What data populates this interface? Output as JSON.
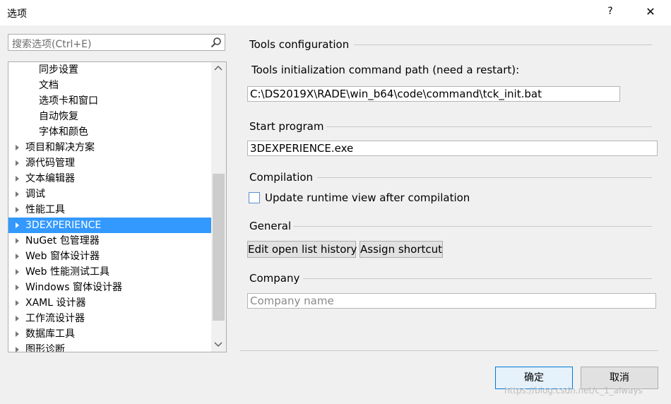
{
  "window": {
    "title": "选项",
    "help_glyph": "?",
    "close_glyph": "✕"
  },
  "search": {
    "placeholder": "搜索选项(Ctrl+E)"
  },
  "tree": {
    "items": [
      {
        "label": "同步设置",
        "indent": 1,
        "expandable": false,
        "selected": false
      },
      {
        "label": "文档",
        "indent": 1,
        "expandable": false,
        "selected": false
      },
      {
        "label": "选项卡和窗口",
        "indent": 1,
        "expandable": false,
        "selected": false
      },
      {
        "label": "自动恢复",
        "indent": 1,
        "expandable": false,
        "selected": false
      },
      {
        "label": "字体和颜色",
        "indent": 1,
        "expandable": false,
        "selected": false
      },
      {
        "label": "项目和解决方案",
        "indent": 0,
        "expandable": true,
        "selected": false
      },
      {
        "label": "源代码管理",
        "indent": 0,
        "expandable": true,
        "selected": false
      },
      {
        "label": "文本编辑器",
        "indent": 0,
        "expandable": true,
        "selected": false
      },
      {
        "label": "调试",
        "indent": 0,
        "expandable": true,
        "selected": false
      },
      {
        "label": "性能工具",
        "indent": 0,
        "expandable": true,
        "selected": false
      },
      {
        "label": "3DEXPERIENCE",
        "indent": 0,
        "expandable": true,
        "selected": true
      },
      {
        "label": "NuGet 包管理器",
        "indent": 0,
        "expandable": true,
        "selected": false
      },
      {
        "label": "Web 窗体设计器",
        "indent": 0,
        "expandable": true,
        "selected": false
      },
      {
        "label": "Web 性能测试工具",
        "indent": 0,
        "expandable": true,
        "selected": false
      },
      {
        "label": "Windows 窗体设计器",
        "indent": 0,
        "expandable": true,
        "selected": false
      },
      {
        "label": "XAML 设计器",
        "indent": 0,
        "expandable": true,
        "selected": false
      },
      {
        "label": "工作流设计器",
        "indent": 0,
        "expandable": true,
        "selected": false
      },
      {
        "label": "数据库工具",
        "indent": 0,
        "expandable": true,
        "selected": false
      },
      {
        "label": "图形诊断",
        "indent": 0,
        "expandable": true,
        "selected": false
      }
    ]
  },
  "panel": {
    "tools_config": {
      "header": "Tools configuration",
      "path_label": "Tools initialization command path (need a restart):",
      "path_value": "C:\\DS2019X\\RADE\\win_b64\\code\\command\\tck_init.bat"
    },
    "start_program": {
      "header": "Start program",
      "value": "3DEXPERIENCE.exe"
    },
    "compilation": {
      "header": "Compilation",
      "checkbox_label": "Update runtime view after compilation",
      "checked": false
    },
    "general": {
      "header": "General",
      "edit_button": "Edit open list history",
      "shortcut_button": "Assign shortcut"
    },
    "company": {
      "header": "Company",
      "placeholder": "Company name"
    }
  },
  "footer": {
    "ok_label": "确定",
    "cancel_label": "取消"
  },
  "watermark": "https://blog.csdn.net/c_1_always",
  "colors": {
    "selection": "#3399ff",
    "focus_border": "#0078d7"
  }
}
